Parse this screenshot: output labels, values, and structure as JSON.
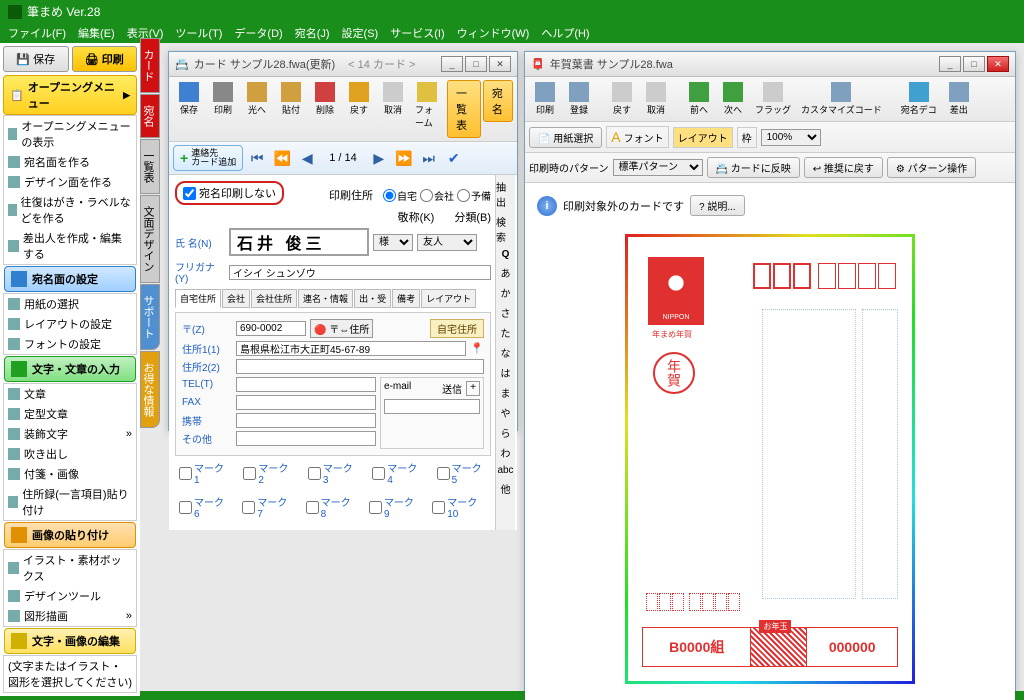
{
  "app": {
    "title": "筆まめ Ver.28"
  },
  "menu": [
    "ファイル(F)",
    "編集(E)",
    "表示(V)",
    "ツール(T)",
    "データ(D)",
    "宛名(J)",
    "設定(S)",
    "サービス(I)",
    "ウィンドウ(W)",
    "ヘルプ(H)"
  ],
  "side": {
    "save": "保存",
    "print": "印刷",
    "opening": "オープニングメニュー",
    "opening_items": [
      "オープニングメニューの表示",
      "宛名面を作る",
      "デザイン面を作る",
      "往復はがき・ラベルなどを作る",
      "差出人を作成・編集する"
    ],
    "addr_header": "宛名面の設定",
    "addr_items": [
      "用紙の選択",
      "レイアウトの設定",
      "フォントの設定"
    ],
    "text_header": "文字・文章の入力",
    "text_items": [
      "文章",
      "定型文章",
      "装飾文字",
      "吹き出し",
      "付箋・画像",
      "住所録(一言項目)貼り付け"
    ],
    "img_header": "画像の貼り付け",
    "img_items": [
      "イラスト・素材ボックス",
      "デザインツール",
      "図形描画"
    ],
    "edit_header": "文字・画像の編集",
    "edit_note": "(文字またはイラスト・図形を選択してください)"
  },
  "sidetabs": [
    "カード",
    "宛名",
    "一覧表",
    "文面デザイン",
    "サポート",
    "お得な情報"
  ],
  "card": {
    "title": "カード  サンプル28.fwa(更新)",
    "count": "< 14 カード >",
    "tools": [
      "保存",
      "印刷",
      "光へ",
      "貼付",
      "削除",
      "戻す",
      "取消",
      "フォーム"
    ],
    "list_btn": "一覧表",
    "addr_btn": "宛 名",
    "contact_add": "連絡先\nカード追加",
    "nav_labels": [
      "先頭",
      "早戻",
      "前へ",
      "次へ",
      "早送",
      "最終",
      "チェック"
    ],
    "pos": "1  /  14",
    "no_print": "宛名印刷しない",
    "print_addr_label": "印刷住所",
    "radios": [
      "自宅",
      "会社",
      "予備"
    ],
    "keisho": "敬称(K)",
    "bunrui": "分類(B)",
    "name_label": "氏 名(N)",
    "name": "石井 俊三",
    "furi_label": "フリガナ(Y)",
    "furi": "イシイ シュンゾウ",
    "keisho_val": "様",
    "bunrui_val": "友人",
    "tabs": [
      "自宅住所",
      "会社",
      "会社住所",
      "連名・情報",
      "出・受",
      "備考",
      "レイアウト"
    ],
    "home_addr_btn": "自宅住所",
    "zip_label": "〒(Z)",
    "zip": "690-0002",
    "zip_lookup": "〒⇔住所",
    "addr1_label": "住所1(1)",
    "addr1": "島根県松江市大正町45-67-89",
    "addr2_label": "住所2(2)",
    "tel_label": "TEL(T)",
    "fax_label": "FAX",
    "mobile_label": "携帯",
    "other_label": "その他",
    "email_label": "e-mail",
    "send_label": "送信",
    "marks": [
      "マーク1",
      "マーク2",
      "マーク3",
      "マーク4",
      "マーク5",
      "マーク6",
      "マーク7",
      "マーク8",
      "マーク9",
      "マーク10"
    ],
    "kana": [
      "抽出",
      "検索",
      "あ",
      "か",
      "さ",
      "た",
      "な",
      "は",
      "ま",
      "や",
      "ら",
      "わ",
      "abc",
      "他"
    ]
  },
  "post": {
    "title": "年賀葉書  サンプル28.fwa",
    "tools": [
      "印刷",
      "登録",
      "戻す",
      "取消",
      "前へ",
      "次へ",
      "フラッグ",
      "カスタマイズコード",
      "宛名デコ",
      "差出"
    ],
    "paper_btn": "用紙選択",
    "grp": [
      "フォント",
      "レイアウト",
      "枠"
    ],
    "zoom": "100%",
    "pattern_label": "印刷時のパターン",
    "pattern_val": "標準パターン",
    "reflect": "カードに反映",
    "revert": "推奨に戻す",
    "patop": "パターン操作",
    "info": "印刷対象外のカードです",
    "help": "説明...",
    "stamp_text": "NIPPON",
    "stamp_sub": "年まめ年賀",
    "nenga": "年賀",
    "lottery_l": "B0000組",
    "lottery_r": "000000"
  }
}
